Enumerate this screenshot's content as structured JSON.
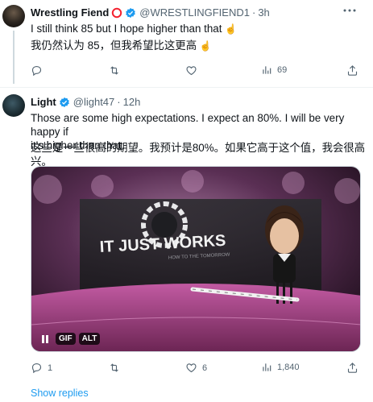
{
  "tweets": [
    {
      "name": "Wrestling Fiend",
      "handle": "@WRESTLINGFIEND1",
      "time": "3h",
      "text_en": "I still think 85 but I hope higher than that",
      "text_zh": "我仍然认为 85，但我希望比这更高",
      "actions": {
        "reply": "",
        "retweet": "",
        "like": "",
        "views": "69"
      }
    },
    {
      "name": "Light",
      "handle": "@light47",
      "time": "12h",
      "text_en_line1": "Those are some high expectations. I expect an 80%. I will be very happy if",
      "text_en_line2": "it's higher than that.",
      "text_zh": "这些是一些很高的期望。我预计是80%。如果它高于这个值，我会很高兴。",
      "media": {
        "stage_text": "IT JUST WORKS",
        "stage_subtext": "HOW TO THE TOMORROW",
        "gif_label": "GIF",
        "alt_label": "ALT"
      },
      "actions": {
        "reply": "1",
        "retweet": "",
        "like": "6",
        "views": "1,840"
      }
    }
  ],
  "show_replies": "Show replies",
  "colors": {
    "verified": "#1d9bf0",
    "link": "#1d9bf0",
    "muted": "#536471",
    "affiliate_ring": "#f4212e"
  }
}
